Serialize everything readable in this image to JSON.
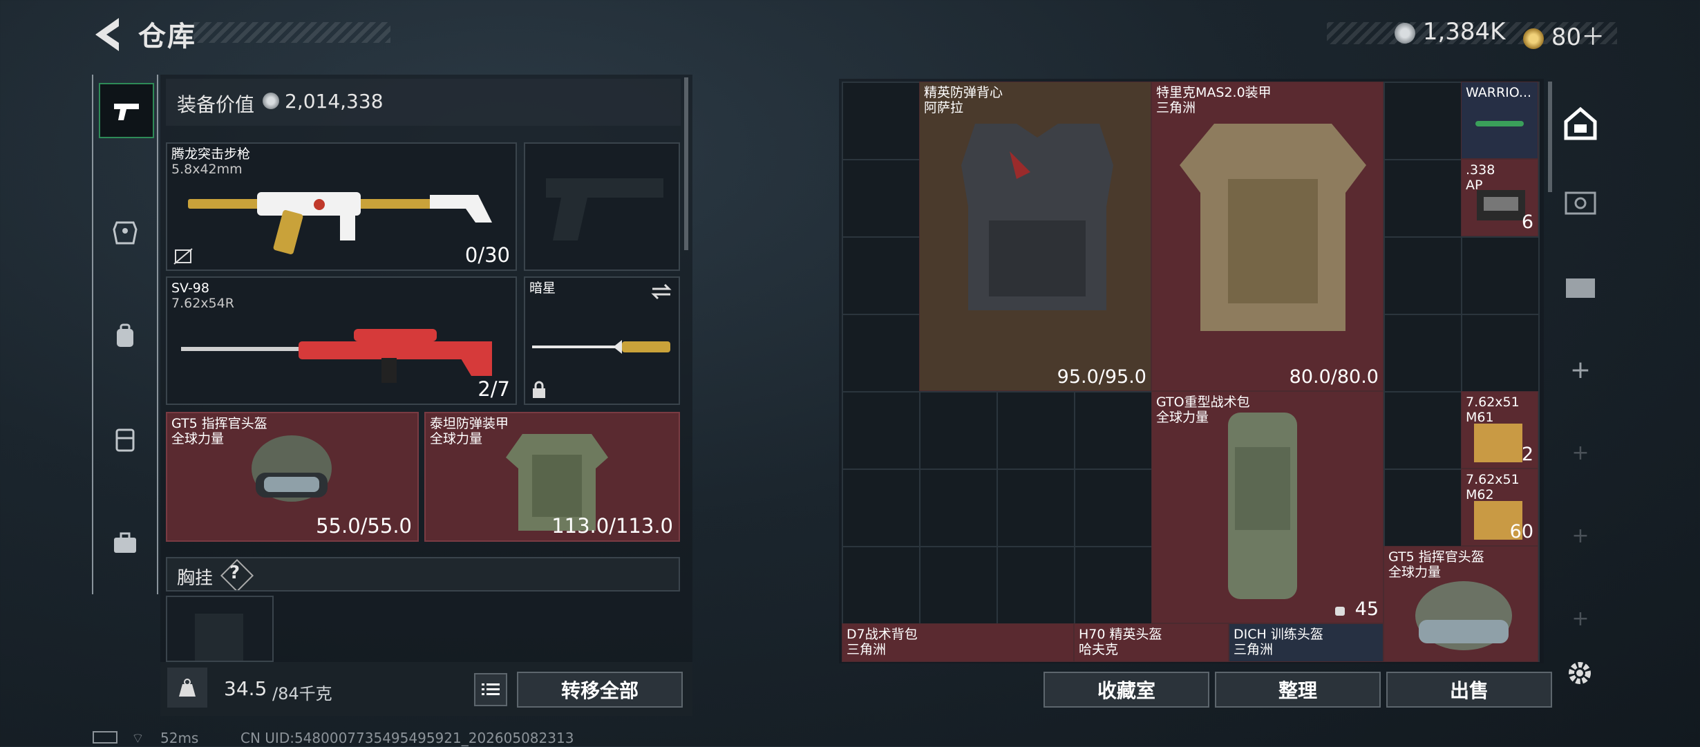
{
  "header": {
    "title": "仓库"
  },
  "currency": {
    "silver": "1,384K",
    "gold": "80＋"
  },
  "equipment_value": {
    "label": "装备价值",
    "value": "2,014,338"
  },
  "slots": {
    "primary": {
      "name": "腾龙突击步枪",
      "ammo": "5.8x42mm",
      "count": "0/30"
    },
    "sniper": {
      "name": "SV-98",
      "ammo": "7.62x54R",
      "count": "2/7"
    },
    "melee": {
      "name": "暗星"
    },
    "helmet": {
      "name": "GT5 指挥官头盔",
      "faction": "全球力量",
      "durability": "55.0/55.0"
    },
    "armor": {
      "name": "泰坦防弹装甲",
      "faction": "全球力量",
      "durability": "113.0/113.0"
    },
    "chest_rig": {
      "label": "胸挂",
      "help": "?"
    }
  },
  "weight": {
    "current": "34.5",
    "max": "/84千克"
  },
  "actions": {
    "transfer_all": "转移全部",
    "collection": "收藏室",
    "organize": "整理",
    "sell": "出售"
  },
  "stash_items": [
    {
      "name": "精英防弹背心",
      "faction": "阿萨拉",
      "durability": "95.0/95.0"
    },
    {
      "name": "特里克MAS2.0装甲",
      "faction": "三角洲",
      "durability": "80.0/80.0"
    },
    {
      "name": "WARRIO..."
    },
    {
      "name": ".338",
      "sub": "AP",
      "count": "6"
    },
    {
      "name": "GTO重型战术包",
      "faction": "全球力量",
      "count": "45"
    },
    {
      "name": "7.62x51",
      "sub": "M61",
      "count": "2"
    },
    {
      "name": "7.62x51",
      "sub": "M62",
      "count": "60"
    },
    {
      "name": "GT5 指挥官头盔",
      "faction": "全球力量"
    },
    {
      "name": "D7战术背包",
      "faction": "三角洲"
    },
    {
      "name": "H70 精英头盔",
      "faction": "哈夫克"
    },
    {
      "name": "DICH 训练头盔",
      "faction": "三角洲"
    }
  ],
  "status": {
    "ping": "52ms",
    "uid": "CN UID:5480007735495495921_202605082313"
  },
  "colors": {
    "slot_red": "#5a2a30",
    "item_tan": "#4a3a2c",
    "active_green": "#2e8b57"
  }
}
